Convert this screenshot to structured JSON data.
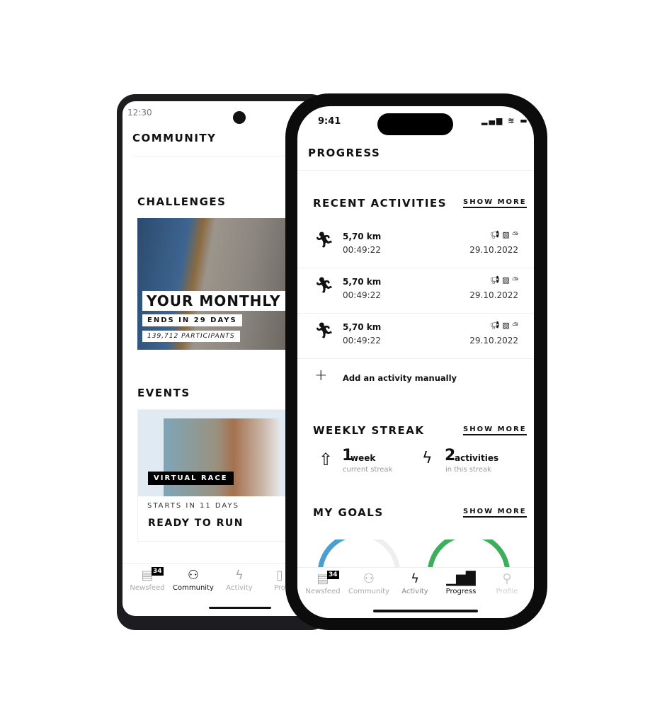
{
  "android": {
    "time": "12:30",
    "title": "COMMUNITY",
    "challenges": {
      "heading": "CHALLENGES",
      "card_title": "YOUR MONTHLY 3",
      "ends": "ENDS IN 29 DAYS",
      "participants": "139,712 PARTICIPANTS"
    },
    "events": {
      "heading": "EVENTS",
      "tag": "VIRTUAL RACE",
      "starts": "STARTS IN 11 DAYS",
      "name": "READY TO RUN"
    },
    "nav": [
      {
        "label": "Newsfeed",
        "badge": "34"
      },
      {
        "label": "Community"
      },
      {
        "label": "Activity"
      },
      {
        "label": "Pro"
      }
    ]
  },
  "iphone": {
    "time": "9:41",
    "title": "PROGRESS",
    "recent": {
      "heading": "RECENT ACTIVITIES",
      "show_more": "SHOW MORE",
      "items": [
        {
          "distance": "5,70 km",
          "duration": "00:49:22",
          "date": "29.10.2022"
        },
        {
          "distance": "5,70 km",
          "duration": "00:49:22",
          "date": "29.10.2022"
        },
        {
          "distance": "5,70 km",
          "duration": "00:49:22",
          "date": "29.10.2022"
        }
      ],
      "add_label": "Add an activity manually"
    },
    "streak": {
      "heading": "WEEKLY STREAK",
      "show_more": "SHOW MORE",
      "weeks_num": "1",
      "weeks_unit": "week",
      "weeks_sub": "current streak",
      "acts_num": "2",
      "acts_unit": "activities",
      "acts_sub": "in this streak"
    },
    "goals": {
      "heading": "MY GOALS",
      "show_more": "SHOW MORE",
      "goal1_progress": 0.5,
      "goal2_progress": 1.0,
      "colors": [
        "#4a9fd0",
        "#3fae5c"
      ]
    },
    "nav": [
      {
        "label": "Newsfeed",
        "badge": "34"
      },
      {
        "label": "Community"
      },
      {
        "label": "Activity"
      },
      {
        "label": "Progress"
      },
      {
        "label": "Profile"
      }
    ]
  }
}
